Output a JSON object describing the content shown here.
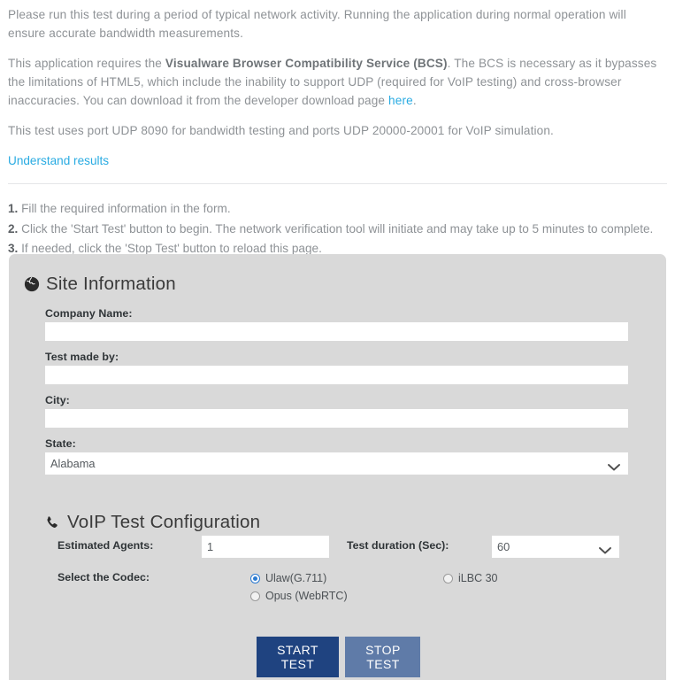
{
  "intro": {
    "p1": "Please run this test during a period of typical network activity. Running the application during normal operation will ensure accurate bandwidth measurements.",
    "p2_before": "This application requires the ",
    "p2_bold": "Visualware Browser Compatibility Service (BCS)",
    "p2_mid": ". The BCS is necessary as it bypasses the limitations of HTML5, which include the inability to support UDP (required for VoIP testing) and cross-browser inaccuracies. You can download it from the developer download page ",
    "p2_link": "here",
    "p2_after": ".",
    "p3": "This test uses port UDP 8090 for bandwidth testing and ports UDP 20000-20001 for VoIP simulation.",
    "understand_results": "Understand results"
  },
  "steps": [
    {
      "num": "1.",
      "text": "Fill the required information in the form."
    },
    {
      "num": "2.",
      "text": "Click the 'Start Test' button to begin. The network verification tool will initiate and may take up to 5 minutes to complete."
    },
    {
      "num": "3.",
      "text": "If needed, click the 'Stop Test' button to reload this page."
    }
  ],
  "site_information": {
    "title": "Site Information",
    "icon": "globe-icon",
    "company_name": {
      "label": "Company Name:",
      "value": "",
      "placeholder": ""
    },
    "test_made_by": {
      "label": "Test made by:",
      "value": "",
      "placeholder": ""
    },
    "city": {
      "label": "City:",
      "value": "",
      "placeholder": ""
    },
    "state": {
      "label": "State:",
      "selected": "Alabama"
    }
  },
  "voip_configuration": {
    "title": "VoIP Test Configuration",
    "icon": "phone-icon",
    "estimated_agents": {
      "label": "Estimated Agents:",
      "value": "1"
    },
    "test_duration": {
      "label": "Test duration (Sec):",
      "selected": "60"
    },
    "codec": {
      "label": "Select the Codec:",
      "options": [
        {
          "label": "Ulaw(G.711)",
          "selected": true
        },
        {
          "label": "Opus (WebRTC)",
          "selected": false
        },
        {
          "label": "iLBC 30",
          "selected": false
        }
      ]
    }
  },
  "buttons": {
    "start": "START TEST",
    "stop": "STOP TEST"
  },
  "colors": {
    "link": "#29abe2",
    "panel_bg": "#d9d9d9",
    "start_button": "#1f4380",
    "stop_button": "#5f7ba8",
    "radio_accent": "#2b7ad1"
  }
}
